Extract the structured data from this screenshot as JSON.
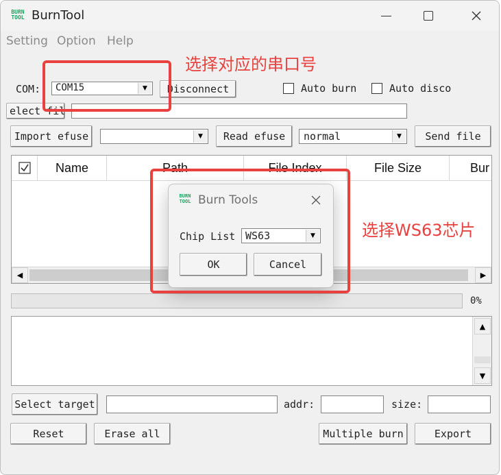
{
  "window": {
    "title": "BurnTool",
    "logo_text": "BURN\nTOOL",
    "minimize_glyph": "—",
    "maximize_glyph": "☐",
    "close_glyph": "✕"
  },
  "menu": {
    "items": [
      "Setting",
      "Option",
      "Help"
    ]
  },
  "toolbar": {
    "com_label": "COM:",
    "com_value": "COM15",
    "disconnect_label": "Disconnect",
    "auto_burn_label": "Auto burn",
    "auto_disconnect_label": "Auto disco",
    "select_file_label": "elect fil",
    "file_path_value": ""
  },
  "efuse_row": {
    "import_efuse_label": "Import efuse",
    "efuse_combo_value": "",
    "read_efuse_label": "Read efuse",
    "mode_combo_value": "normal",
    "send_file_label": "Send file"
  },
  "file_table": {
    "columns": [
      "Name",
      "Path",
      "File Index",
      "File Size",
      "Bur"
    ]
  },
  "progress": {
    "percent_text": "0%",
    "value": 0
  },
  "bottom": {
    "select_target_label": "Select target",
    "target_value": "",
    "addr_label": "addr:",
    "addr_value": "",
    "size_label": "size:",
    "size_value": "",
    "reset_label": "Reset",
    "erase_all_label": "Erase all",
    "multiple_burn_label": "Multiple burn",
    "export_label": "Export"
  },
  "dialog": {
    "title": "Burn Tools",
    "chip_list_label": "Chip List",
    "chip_value": "WS63",
    "ok_label": "OK",
    "cancel_label": "Cancel"
  },
  "annotations": {
    "com_note": "选择对应的串口号",
    "chip_note": "选择WS63芯片",
    "accent_color": "#e8413f"
  }
}
